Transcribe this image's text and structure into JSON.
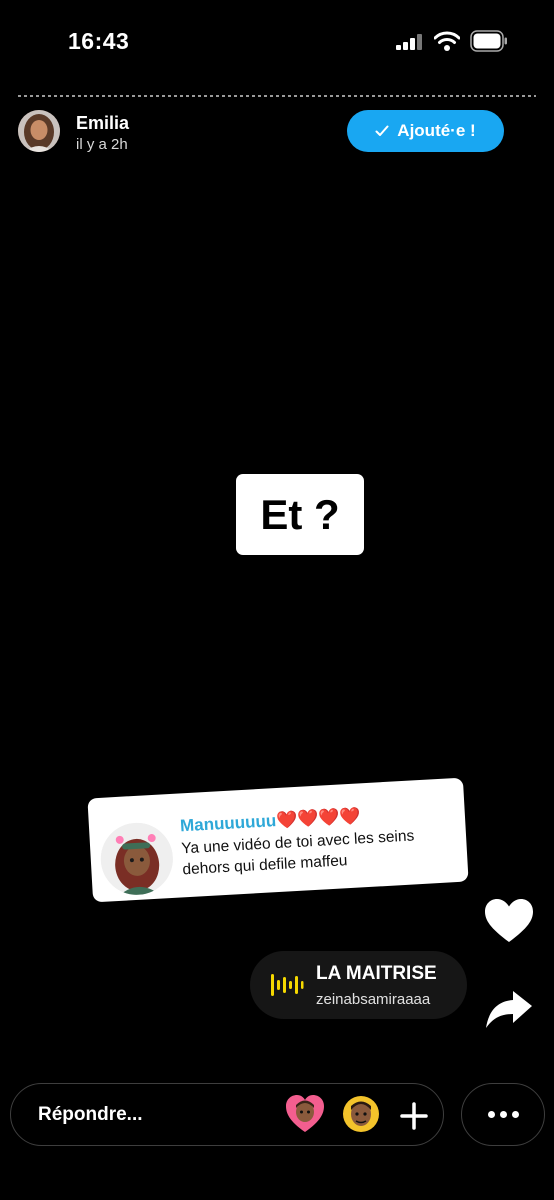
{
  "status_bar": {
    "time": "16:43"
  },
  "header": {
    "username": "Emilia",
    "timestamp": "il y a 2h",
    "added_button": "Ajouté·e !"
  },
  "story": {
    "center_text": "Et ?"
  },
  "comment": {
    "author": "Manuuuuuu",
    "hearts": "❤️❤️❤️❤️",
    "text": "Ya une vidéo de toi avec les seins dehors qui defile maffeu"
  },
  "music": {
    "title": "LA MAITRISE",
    "artist": "zeinabsamiraaaa"
  },
  "reply": {
    "label": "Répondre..."
  },
  "colors": {
    "accent": "#19a7f2",
    "comment_author": "#2ea8d8",
    "music_icon": "#f5d800"
  }
}
